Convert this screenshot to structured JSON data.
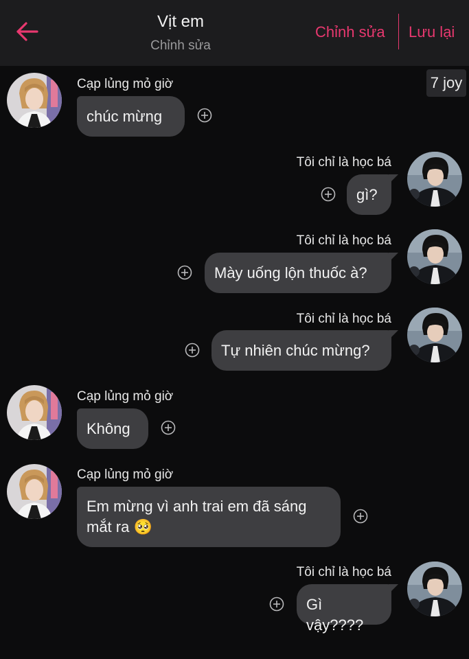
{
  "header": {
    "title": "Vịt em",
    "subtitle": "Chỉnh sửa",
    "edit_label": "Chỉnh sửa",
    "save_label": "Lưu lại",
    "accent_color": "#e8386f"
  },
  "badge": "7 joy",
  "messages": [
    {
      "side": "left",
      "sender": "Cạp lủng mỏ giờ",
      "text": "chúc mừng"
    },
    {
      "side": "right",
      "sender": "Tôi chỉ là học bá",
      "text": "gì?"
    },
    {
      "side": "right",
      "sender": "Tôi chỉ là học bá",
      "text": "Mày uống lộn thuốc à?"
    },
    {
      "side": "right",
      "sender": "Tôi chỉ là học bá",
      "text": "Tự nhiên chúc mừng?"
    },
    {
      "side": "left",
      "sender": "Cạp lủng mỏ giờ",
      "text": "Không"
    },
    {
      "side": "left",
      "sender": "Cạp lủng mỏ giờ",
      "text": "Em mừng vì anh trai em đã sáng",
      "text2": "mắt ra 🥺"
    },
    {
      "side": "right",
      "sender": "Tôi chỉ là học bá",
      "text": "Gì vậy????"
    }
  ]
}
